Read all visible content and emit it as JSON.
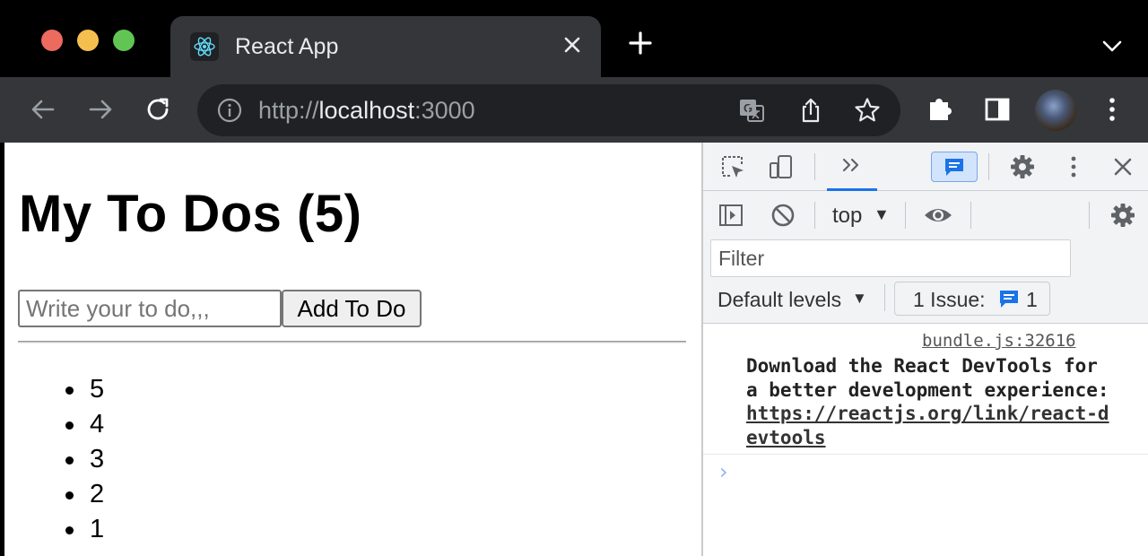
{
  "browser": {
    "tab": {
      "title": "React App",
      "icon": "react-logo-icon"
    },
    "url": {
      "scheme": "http://",
      "host": "localhost",
      "port": ":3000"
    }
  },
  "page": {
    "heading": "My To Dos (5)",
    "input": {
      "placeholder": "Write your to do,,,",
      "value": ""
    },
    "add_button": "Add To Do",
    "todos": [
      "5",
      "4",
      "3",
      "2",
      "1"
    ]
  },
  "devtools": {
    "context": "top",
    "filter_placeholder": "Filter",
    "levels": "Default levels",
    "issues": {
      "label": "1 Issue:",
      "count": "1"
    },
    "log": {
      "source": "bundle.js:32616",
      "message": "Download the React DevTools for a better development experience: ",
      "link": "https://reactjs.org/link/react-devtools"
    },
    "prompt": "›"
  },
  "colors": {
    "titlebar": "#000000",
    "toolbar": "#35363a",
    "omnibox": "#202124",
    "accent": "#1a73e8",
    "react": "#61dafb"
  }
}
